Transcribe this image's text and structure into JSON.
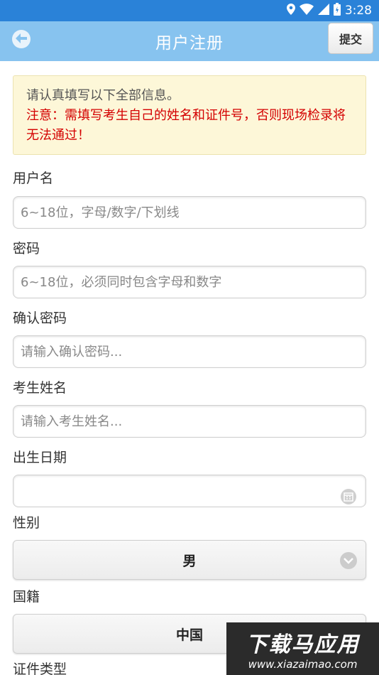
{
  "status_bar": {
    "time": "3:28",
    "icons": [
      "location-icon",
      "wifi-icon",
      "signal-icon",
      "battery-icon"
    ]
  },
  "app_bar": {
    "title": "用户注册",
    "submit_label": "提交"
  },
  "notice": {
    "line1": "请认真填写以下全部信息。",
    "warning": "注意：需填写考生自己的姓名和证件号，否则现场检录将无法通过！"
  },
  "form": {
    "username": {
      "label": "用户名",
      "placeholder": "6~18位，字母/数字/下划线"
    },
    "password": {
      "label": "密码",
      "placeholder": "6~18位，必须同时包含字母和数字"
    },
    "confirm_password": {
      "label": "确认密码",
      "placeholder": "请输入确认密码..."
    },
    "name": {
      "label": "考生姓名",
      "placeholder": "请输入考生姓名..."
    },
    "birth_date": {
      "label": "出生日期",
      "value": ""
    },
    "gender": {
      "label": "性别",
      "selected": "男"
    },
    "nationality": {
      "label": "国籍",
      "selected": "中国"
    },
    "id_type": {
      "label": "证件类型"
    }
  },
  "watermark": {
    "brand": "下载马应用",
    "url": "www.xiazaimao.com"
  },
  "colors": {
    "status_bar": "#2a82d8",
    "app_bar": "#87c3ef",
    "warning": "#d40000",
    "notice_bg": "#fdf7d8"
  }
}
